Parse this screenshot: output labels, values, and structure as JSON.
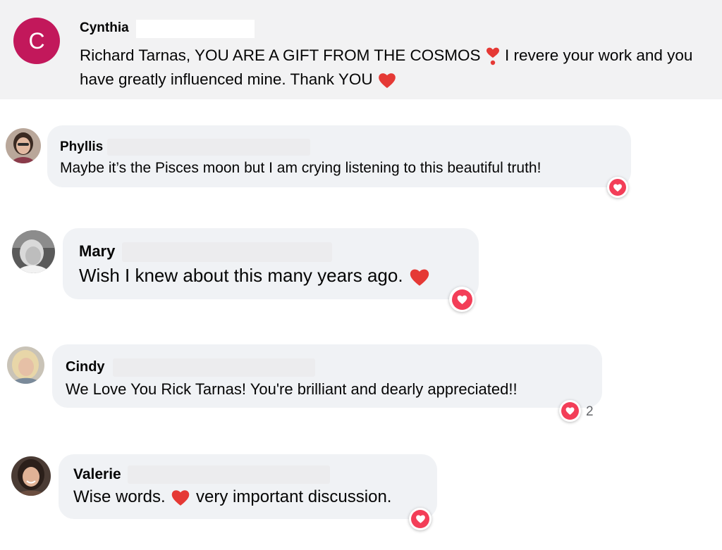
{
  "comments": [
    {
      "avatar_letter": "C",
      "name": "Cynthia",
      "text_before": "Richard Tarnas, YOU ARE A GIFT FROM THE COSMOS",
      "text_middle": " I revere your work and you have greatly influenced mine. Thank YOU",
      "avatar_color": "#c2185b"
    },
    {
      "name": "Phyllis",
      "text": "Maybe it’s the Pisces moon but I am crying listening to this beautiful truth!"
    },
    {
      "name": "Mary",
      "text": "Wish I knew about this many years ago."
    },
    {
      "name": "Cindy",
      "text": "We Love You Rick Tarnas! You're brilliant and dearly appreciated!!",
      "reaction_count": "2"
    },
    {
      "name": "Valerie",
      "text_before": "Wise words.",
      "text_after": " very important discussion."
    }
  ],
  "colors": {
    "bubble": "#f0f2f5",
    "heart_red": "#f33e58",
    "emoji_heart": "#e53935"
  },
  "icons": {
    "reaction": "heart-icon",
    "emoji": "red-heart-emoji",
    "exclamation": "heart-exclamation-emoji"
  }
}
